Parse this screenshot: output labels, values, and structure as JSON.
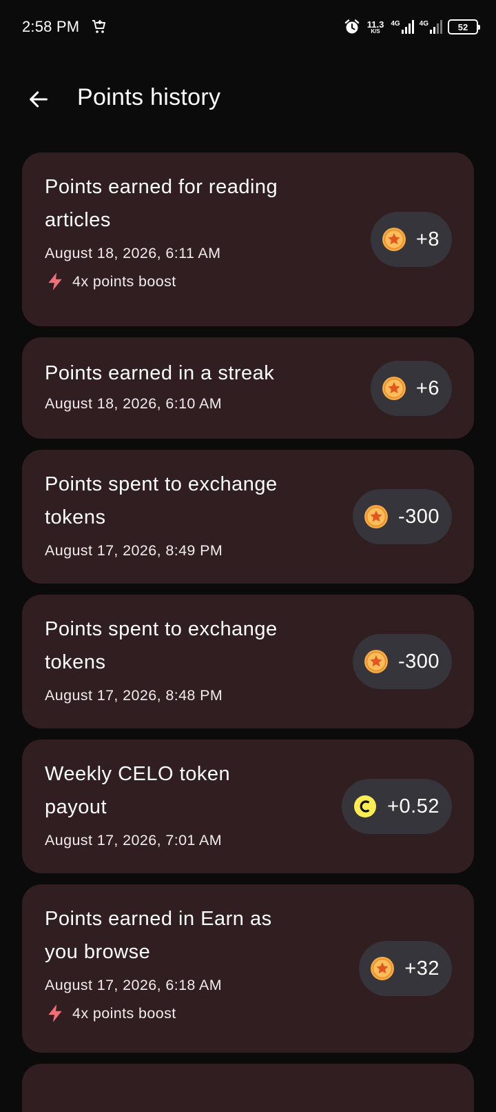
{
  "status_bar": {
    "time": "2:58 PM",
    "net_speed": "11.3",
    "net_speed_unit": "K/S",
    "network_1": "4G",
    "network_2": "4G",
    "battery": "52",
    "icons": [
      "shopping-cart-icon",
      "alarm-icon",
      "signal-icon",
      "battery-icon"
    ]
  },
  "header": {
    "title": "Points history",
    "back_icon": "arrow-left-icon"
  },
  "colors": {
    "background": "#0b0b0b",
    "card": "#311e20",
    "pill": "#36353b",
    "boost": "#f0707a",
    "coin": "#f5a843",
    "celo": "#fcee52"
  },
  "history": [
    {
      "title_line1": "Points earned for reading",
      "title_line2": "articles",
      "date": "August 18, 2026, 6:11 AM",
      "boost": "4x points boost",
      "amount": "+8",
      "icon": "star-coin-icon"
    },
    {
      "title_line1": "Points earned in a streak",
      "date": "August 18, 2026, 6:10 AM",
      "amount": "+6",
      "icon": "star-coin-icon"
    },
    {
      "title_line1": "Points spent to exchange",
      "title_line2": "tokens",
      "date": "August 17, 2026, 8:49 PM",
      "amount": "-300",
      "icon": "star-coin-icon"
    },
    {
      "title_line1": "Points spent to exchange",
      "title_line2": "tokens",
      "date": "August 17, 2026, 8:48 PM",
      "amount": "-300",
      "icon": "star-coin-icon"
    },
    {
      "title_line1": "Weekly CELO token",
      "title_line2": "payout",
      "date": "August 17, 2026, 7:01 AM",
      "amount": "+0.52",
      "icon": "celo-icon"
    },
    {
      "title_line1": "Points earned in Earn as",
      "title_line2": "you browse",
      "date": "August 17, 2026, 6:18 AM",
      "boost": "4x points boost",
      "amount": "+32",
      "icon": "star-coin-icon"
    }
  ]
}
